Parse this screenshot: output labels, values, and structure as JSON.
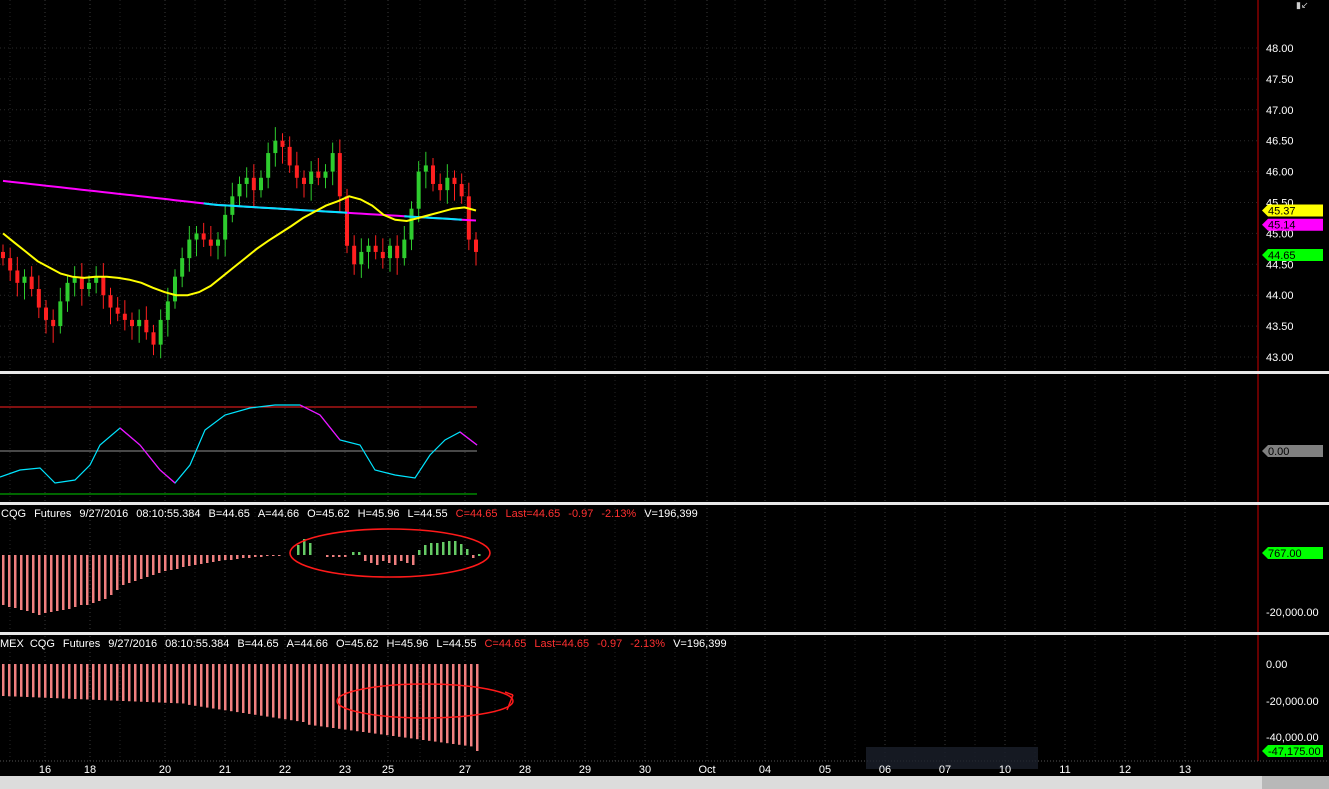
{
  "chart_data": [
    {
      "type": "candlestick",
      "panel": "price",
      "y_ticks": [
        "48.00",
        "47.50",
        "47.00",
        "46.50",
        "46.00",
        "45.50",
        "45.00",
        "44.50",
        "44.00",
        "43.50",
        "43.00"
      ],
      "ylim": [
        43.0,
        48.0
      ],
      "last_markers": [
        {
          "label": "45.37",
          "value": 45.37,
          "color": "#ffff00",
          "text_color": "#000000"
        },
        {
          "label": "45.14",
          "value": 45.14,
          "color": "#ff00ff",
          "text_color": "#000000"
        },
        {
          "label": "44.65",
          "value": 44.65,
          "color": "#00ff00",
          "text_color": "#000000"
        }
      ],
      "series_colors": {
        "up": "#2ecc2e",
        "down": "#ff2020",
        "ma_fast": "#ffff00",
        "ma_slow_below": "#00e5ff",
        "ma_slow_above": "#ff00ff"
      }
    },
    {
      "type": "line",
      "panel": "oscillator",
      "last_marker": {
        "label": "0.00",
        "color": "#808080"
      },
      "band_colors": {
        "upper": "#ff2020",
        "lower": "#00cc00",
        "mid": "#cccccc"
      }
    },
    {
      "type": "bar",
      "panel": "histogram-1",
      "y_ticks": [
        "-20,000.00"
      ],
      "last_marker": {
        "label": "767.00",
        "color": "#00ff00"
      },
      "colors": {
        "negative": "#f08080",
        "positive": "#66cc66"
      }
    },
    {
      "type": "bar",
      "panel": "histogram-2",
      "y_ticks": [
        "0.00",
        "-20,000.00",
        "-40,000.00"
      ],
      "last_marker": {
        "label": "-47,175.00",
        "color": "#00ff00"
      },
      "colors": {
        "negative": "#f08080"
      }
    }
  ],
  "x_axis": {
    "labels": [
      "16",
      "18",
      "20",
      "21",
      "22",
      "23",
      "25",
      "27",
      "28",
      "29",
      "30",
      "Oct",
      "04",
      "05",
      "06",
      "07",
      "10",
      "11",
      "12",
      "13"
    ]
  },
  "status_line_1": {
    "source": "CQG",
    "feed": "Futures",
    "date": "9/27/2016",
    "time": "08:10:55.384",
    "bid": "B=44.65",
    "ask": "A=44.66",
    "open": "O=45.62",
    "high": "H=45.96",
    "low": "L=44.55",
    "close": "C=44.65",
    "last": "Last=44.65",
    "change": "-0.97",
    "change_pct": "-2.13%",
    "volume": "V=196,399"
  },
  "status_line_2": {
    "prefix": "MEX",
    "source": "CQG",
    "feed": "Futures",
    "date": "9/27/2016",
    "time": "08:10:55.384",
    "bid": "B=44.65",
    "ask": "A=44.66",
    "open": "O=45.62",
    "high": "H=45.96",
    "low": "L=44.55",
    "close": "C=44.65",
    "last": "Last=44.65",
    "change": "-0.97",
    "change_pct": "-2.13%",
    "volume": "V=196,399"
  }
}
